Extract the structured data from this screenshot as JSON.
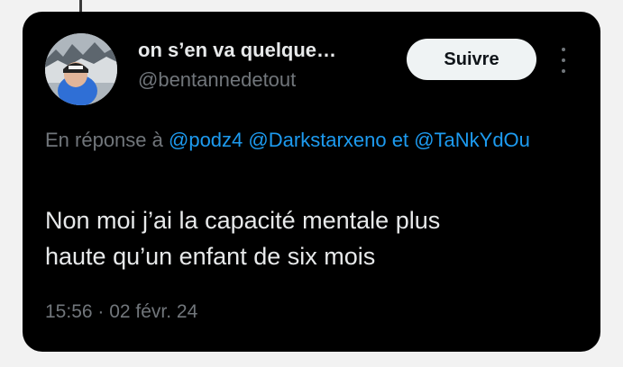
{
  "tweet": {
    "author": {
      "display_name": "on s’en va quelque…",
      "handle": "@bentannedetout",
      "avatar_icon": "profile-photo"
    },
    "follow_label": "Suivre",
    "more_icon": "more-vertical-icon",
    "reply": {
      "prefix": "En réponse à",
      "mentions": [
        "@podz4",
        "@Darkstarxeno",
        "@TaNkYdOu"
      ],
      "conjunction": "et"
    },
    "text_lines": [
      "Non moi j’ai la capacité mentale plus",
      "haute qu’un enfant de six mois"
    ],
    "timestamp": "15:56 · 02 févr. 24"
  },
  "colors": {
    "background": "#000000",
    "text": "#e7e9ea",
    "muted": "#71767b",
    "link": "#1d9bf0",
    "button_bg": "#eff3f4"
  }
}
